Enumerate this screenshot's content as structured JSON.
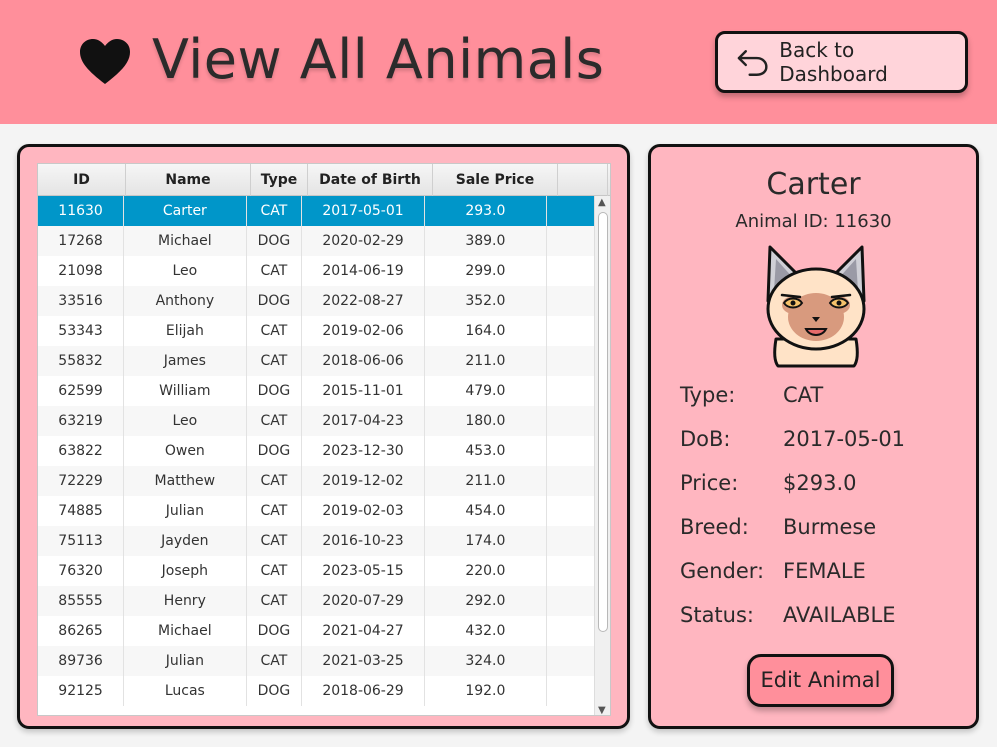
{
  "header": {
    "title": "View All Animals",
    "back_label": "Back to Dashboard"
  },
  "colors": {
    "header_bg": "#ff8f9b",
    "panel_bg": "#ffb6c0",
    "selected_row": "#0096c9"
  },
  "table": {
    "columns": [
      "ID",
      "Name",
      "Type",
      "Date of Birth",
      "Sale Price",
      ""
    ],
    "selected_index": 0,
    "rows": [
      [
        "11630",
        "Carter",
        "CAT",
        "2017-05-01",
        "293.0"
      ],
      [
        "17268",
        "Michael",
        "DOG",
        "2020-02-29",
        "389.0"
      ],
      [
        "21098",
        "Leo",
        "CAT",
        "2014-06-19",
        "299.0"
      ],
      [
        "33516",
        "Anthony",
        "DOG",
        "2022-08-27",
        "352.0"
      ],
      [
        "53343",
        "Elijah",
        "CAT",
        "2019-02-06",
        "164.0"
      ],
      [
        "55832",
        "James",
        "CAT",
        "2018-06-06",
        "211.0"
      ],
      [
        "62599",
        "William",
        "DOG",
        "2015-11-01",
        "479.0"
      ],
      [
        "63219",
        "Leo",
        "CAT",
        "2017-04-23",
        "180.0"
      ],
      [
        "63822",
        "Owen",
        "DOG",
        "2023-12-30",
        "453.0"
      ],
      [
        "72229",
        "Matthew",
        "CAT",
        "2019-12-02",
        "211.0"
      ],
      [
        "74885",
        "Julian",
        "CAT",
        "2019-02-03",
        "454.0"
      ],
      [
        "75113",
        "Jayden",
        "CAT",
        "2016-10-23",
        "174.0"
      ],
      [
        "76320",
        "Joseph",
        "CAT",
        "2023-05-15",
        "220.0"
      ],
      [
        "85555",
        "Henry",
        "CAT",
        "2020-07-29",
        "292.0"
      ],
      [
        "86265",
        "Michael",
        "DOG",
        "2021-04-27",
        "432.0"
      ],
      [
        "89736",
        "Julian",
        "CAT",
        "2021-03-25",
        "324.0"
      ],
      [
        "92125",
        "Lucas",
        "DOG",
        "2018-06-29",
        "192.0"
      ]
    ]
  },
  "detail": {
    "name": "Carter",
    "id_label": "Animal ID:",
    "id_value": "11630",
    "icon": "cat-face-icon",
    "fields": [
      {
        "label": "Type:",
        "value": "CAT"
      },
      {
        "label": "DoB:",
        "value": "2017-05-01"
      },
      {
        "label": "Price:",
        "value": "$293.0"
      },
      {
        "label": "Breed:",
        "value": "Burmese"
      },
      {
        "label": "Gender:",
        "value": "FEMALE"
      },
      {
        "label": "Status:",
        "value": "AVAILABLE"
      }
    ],
    "edit_label": "Edit Animal"
  }
}
